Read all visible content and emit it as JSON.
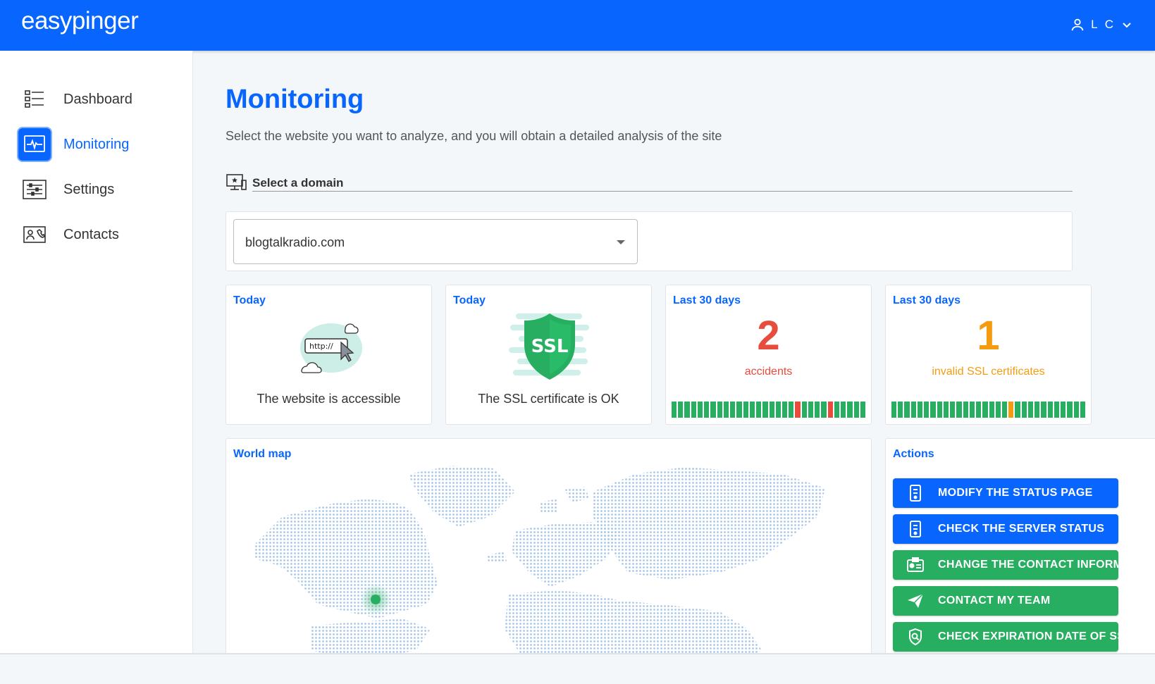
{
  "app": {
    "logo": "easypinger"
  },
  "user": {
    "initials": "L C"
  },
  "sidebar": {
    "items": [
      {
        "label": "Dashboard",
        "active": false
      },
      {
        "label": "Monitoring",
        "active": true
      },
      {
        "label": "Settings",
        "active": false
      },
      {
        "label": "Contacts",
        "active": false
      }
    ]
  },
  "main": {
    "title": "Monitoring",
    "subtitle": "Select the website you want to analyze, and you will obtain a detailed analysis of the site",
    "domain_section_label": "Select a domain",
    "selected_domain": "blogtalkradio.com"
  },
  "cards": {
    "access": {
      "title": "Today",
      "caption": "The website is accessible",
      "http_text": "http://"
    },
    "ssl": {
      "title": "Today",
      "caption": "The SSL certificate is OK",
      "badge_text": "SSL"
    },
    "accidents": {
      "title": "Last 30 days",
      "count": "2",
      "label": "accidents",
      "days": [
        "ok",
        "ok",
        "ok",
        "ok",
        "ok",
        "ok",
        "ok",
        "ok",
        "ok",
        "ok",
        "ok",
        "ok",
        "ok",
        "ok",
        "ok",
        "ok",
        "ok",
        "ok",
        "ok",
        "bad",
        "ok",
        "ok",
        "ok",
        "ok",
        "bad",
        "ok",
        "ok",
        "ok",
        "ok",
        "ok"
      ]
    },
    "ssl_invalid": {
      "title": "Last 30 days",
      "count": "1",
      "label": "invalid SSL certificates",
      "days": [
        "ok",
        "ok",
        "ok",
        "ok",
        "ok",
        "ok",
        "ok",
        "ok",
        "ok",
        "ok",
        "ok",
        "ok",
        "ok",
        "ok",
        "ok",
        "ok",
        "ok",
        "ok",
        "warn",
        "ok",
        "ok",
        "ok",
        "ok",
        "ok",
        "ok",
        "ok",
        "ok",
        "ok",
        "ok",
        "ok"
      ]
    }
  },
  "world_map": {
    "title": "World map"
  },
  "actions": {
    "title": "Actions",
    "buttons": [
      {
        "label": "MODIFY THE STATUS PAGE",
        "icon": "server-icon",
        "color": "#0866ff"
      },
      {
        "label": "CHECK THE SERVER STATUS",
        "icon": "server-icon",
        "color": "#0866ff"
      },
      {
        "label": "CHANGE THE CONTACT INFORMATION",
        "icon": "contact-card-icon",
        "color": "#27ae60"
      },
      {
        "label": "CONTACT MY TEAM",
        "icon": "paper-plane-icon",
        "color": "#27ae60"
      },
      {
        "label": "CHECK EXPIRATION DATE OF SSL",
        "icon": "shield-search-icon",
        "color": "#27ae60"
      }
    ]
  },
  "colors": {
    "primary": "#0866ff",
    "ok": "#27ae60",
    "danger": "#e74c3c",
    "warning": "#f39c12"
  }
}
